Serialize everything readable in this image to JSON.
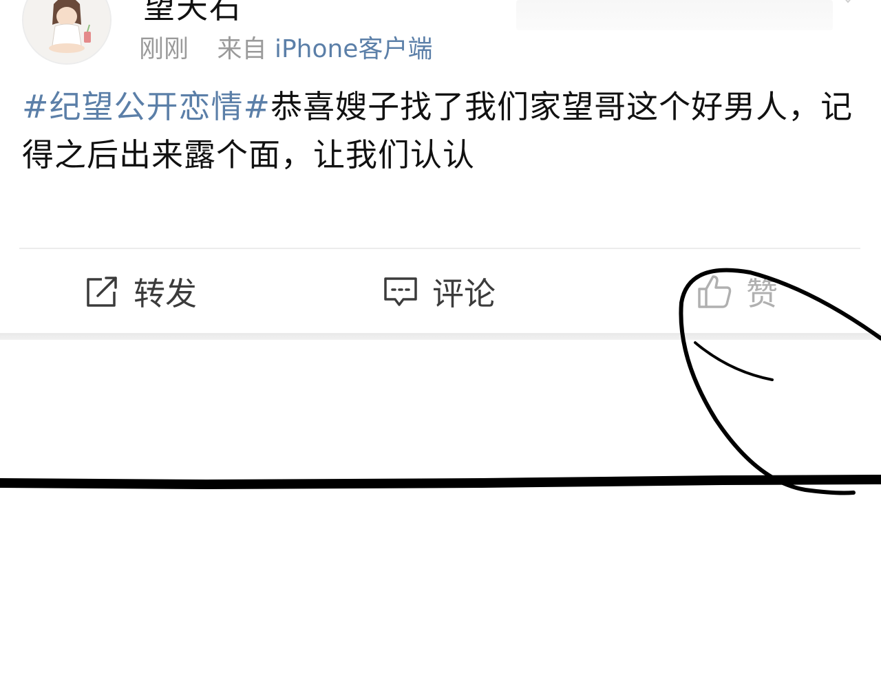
{
  "post": {
    "username": "望天石",
    "time": "刚刚",
    "source_prefix": "来自",
    "source": "iPhone客户端",
    "hashtag": "#纪望公开恋情#",
    "text": "恭喜嫂子找了我们家望哥这个好男人，记得之后出来露个面，让我们认认"
  },
  "actions": {
    "repost_label": "转发",
    "comment_label": "评论",
    "like_label": "赞"
  },
  "icons": {
    "repost": "share-square-arrow-icon",
    "comment": "comment-bubble-icon",
    "like": "thumbs-up-icon"
  },
  "colors": {
    "hashtag": "#5b7fa8",
    "text": "#111111",
    "meta": "#9a9a9a",
    "action_text": "#3b3b3b",
    "overlay_ink": "#000000"
  }
}
